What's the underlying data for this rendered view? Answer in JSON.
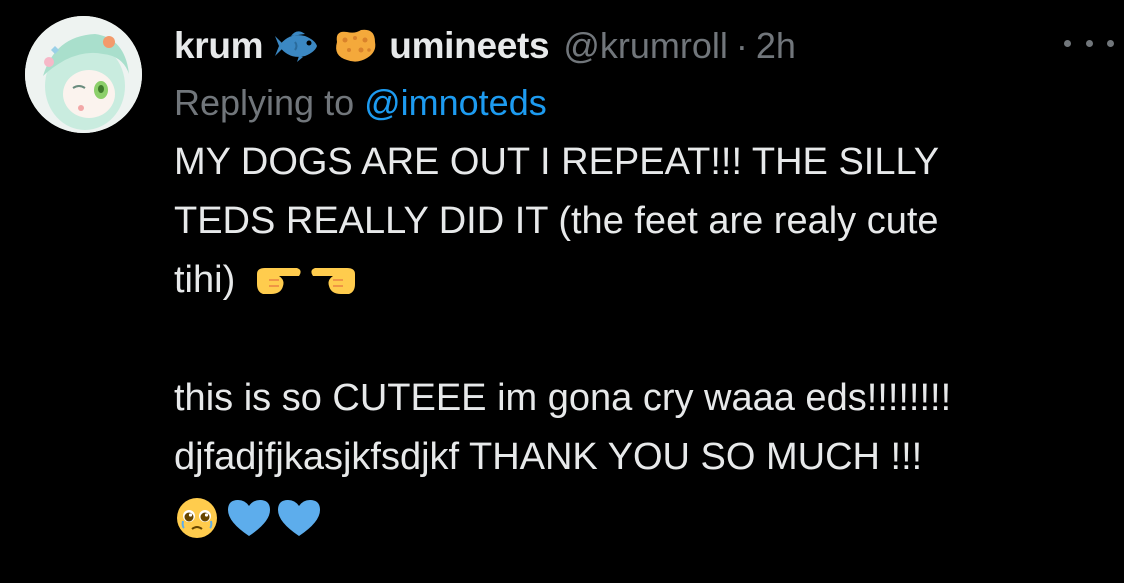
{
  "tweet": {
    "author": {
      "display_name_part1": "krum",
      "display_name_part2": "umineets",
      "name_emojis": [
        "fish-icon",
        "sponge-icon"
      ],
      "handle": "@krumroll",
      "separator": "·",
      "time": "2h"
    },
    "reply": {
      "prefix": "Replying to ",
      "mention": "@imnoteds"
    },
    "body": {
      "line1": "MY DOGS ARE OUT I REPEAT!!! THE SILLY",
      "line2": "TEDS REALLY DID IT (the feet are realy cute",
      "line3": "tihi)",
      "line3_emojis": [
        "pointing-right-hand-icon",
        "pointing-left-hand-icon"
      ],
      "line5": "this is so CUTEEE im gona cry waaa eds!!!!!!!!",
      "line6": "djfadjfjkasjkfsdjkf THANK YOU SO MUCH !!!",
      "line7_emojis": [
        "pleading-face-icon",
        "blue-heart-icon",
        "blue-heart-icon"
      ]
    },
    "colors": {
      "background": "#000000",
      "text_primary": "#e7e9ea",
      "text_secondary": "#71767b",
      "link": "#1d9bf0",
      "heart": "#5dadec"
    }
  }
}
